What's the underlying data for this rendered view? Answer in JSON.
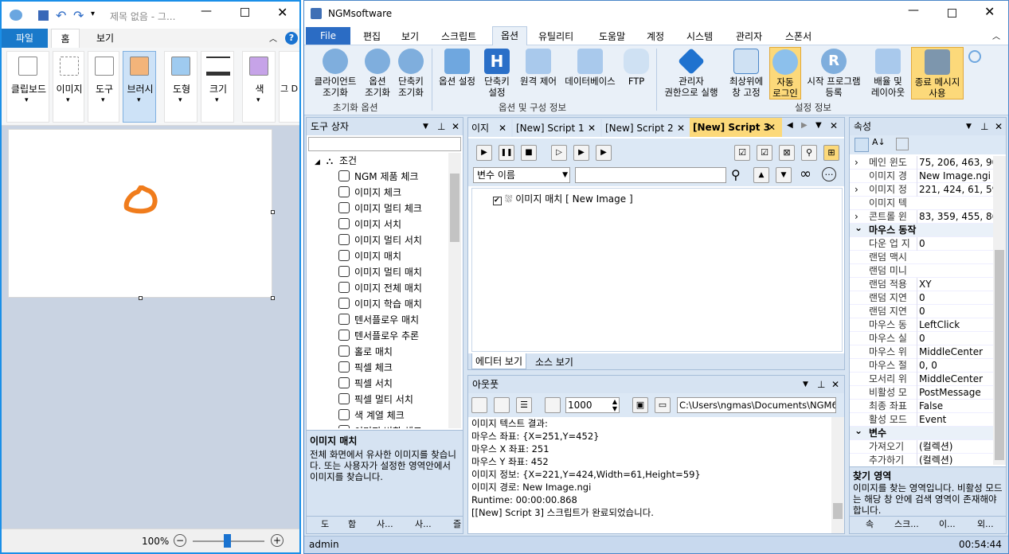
{
  "paint": {
    "title": "제목 없음 - 그...",
    "tabs": [
      "파일",
      "홈",
      "보기"
    ],
    "groups": [
      {
        "label": "클립보드",
        "icon": "clipboard-icon"
      },
      {
        "label": "이미지",
        "icon": "image-select-icon"
      },
      {
        "label": "도구",
        "icon": "tools-icon"
      },
      {
        "label": "브러시",
        "icon": "brush-icon"
      },
      {
        "label": "도형",
        "icon": "shapes-icon"
      },
      {
        "label": "크기",
        "icon": "size-icon"
      },
      {
        "label": "색",
        "icon": "color-icon"
      },
      {
        "label": "그 D",
        "icon": "paint3d-icon"
      }
    ],
    "zoom": "100%"
  },
  "ngm": {
    "title": "NGMsoftware",
    "menu": [
      "File",
      "편집",
      "보기",
      "스크립트",
      "옵션",
      "유틸리티",
      "도움말",
      "계정",
      "시스템",
      "관리자",
      "스폰서"
    ],
    "ribbon": {
      "buttons": [
        {
          "label1": "클라이언트",
          "label2": "조기화"
        },
        {
          "label1": "옵션",
          "label2": "조기화"
        },
        {
          "label1": "단축키",
          "label2": "조기화"
        },
        {
          "label1": "옵션 설정",
          "label2": ""
        },
        {
          "label1": "단축키",
          "label2": "설정"
        },
        {
          "label1": "원격 제어",
          "label2": ""
        },
        {
          "label1": "데이터베이스",
          "label2": ""
        },
        {
          "label1": "FTP",
          "label2": ""
        },
        {
          "label1": "관리자",
          "label2": "권한으로 실행"
        },
        {
          "label1": "최상위에",
          "label2": "창 고정"
        },
        {
          "label1": "자동",
          "label2": "로그인"
        },
        {
          "label1": "시작 프로그램",
          "label2": "등록"
        },
        {
          "label1": "배율 및",
          "label2": "레이아웃"
        },
        {
          "label1": "종료 메시지",
          "label2": "사용"
        }
      ],
      "groups": [
        "초기화 옵션",
        "옵션 및 구성 정보",
        "설정 정보"
      ]
    },
    "toolbox": {
      "title": "도구 상자",
      "root": "조건",
      "items": [
        "NGM 제품 체크",
        "이미지 체크",
        "이미지 멀티 체크",
        "이미지 서치",
        "이미지 멀티 서치",
        "이미지 매치",
        "이미지 멀티 매치",
        "이미지 전체 매치",
        "이미지 학습 매치",
        "텐서플로우 매치",
        "텐서플로우 추론",
        "홀로 매치",
        "픽셀 체크",
        "픽셀 서치",
        "픽셀 멀티 서치",
        "색 계열 체크",
        "이미지 변화 체크"
      ],
      "desc_title": "이미지 매치",
      "desc": "전체 화면에서 유사한 이미지를 찾습니다. 또는 사용자가 설정한 영역안에서 이미지를 찾습니다.",
      "bottom_tabs": [
        "도",
        "함",
        "사...",
        "사...",
        "즐"
      ]
    },
    "editor": {
      "tabs": [
        "이지",
        "[New] Script 1",
        "[New] Script 2",
        "[New] Script 3"
      ],
      "variable_select": "변수 이름",
      "script_line": "이미지 매치 [ New Image ]",
      "view_tabs": [
        "에디터 보기",
        "소스 보기"
      ]
    },
    "output": {
      "title": "아웃풋",
      "count": "1000",
      "path": "C:\\Users\\ngmas\\Documents\\NGM6\\",
      "lines": [
        "이미지 텍스트 결과:",
        "마우스 좌표: {X=251,Y=452}",
        "마우스 X 좌표: 251",
        "마우스 Y 좌표: 452",
        "이미지 정보: {X=221,Y=424,Width=61,Height=59}",
        "이미지 경로: New Image.ngi",
        "Runtime: 00:00:00.868",
        "[[New] Script 3] 스크립트가 완료되었습니다."
      ]
    },
    "properties": {
      "title": "속성",
      "rows": [
        {
          "k": "메인 윈도",
          "v": "75, 206, 463, 902",
          "expand": true
        },
        {
          "k": "이미지 경",
          "v": "New Image.ngi",
          "expand": false
        },
        {
          "k": "이미지 정",
          "v": "221, 424, 61, 59",
          "expand": true
        },
        {
          "k": "이미지 텍",
          "v": "",
          "expand": false
        },
        {
          "k": "콘트롤 윈",
          "v": "83, 359, 455, 868",
          "expand": true
        }
      ],
      "section1": "마우스 동작",
      "rows2": [
        {
          "k": "다운 업 지",
          "v": "0"
        },
        {
          "k": "랜덤 맥시",
          "v": ""
        },
        {
          "k": "랜덤 미니",
          "v": ""
        },
        {
          "k": "랜덤 적용",
          "v": "XY"
        },
        {
          "k": "랜덤 지연",
          "v": "0"
        },
        {
          "k": "랜덤 지연",
          "v": "0"
        },
        {
          "k": "마우스 동",
          "v": "LeftClick"
        },
        {
          "k": "마우스 실",
          "v": "0"
        },
        {
          "k": "마우스 위",
          "v": "MiddleCenter"
        },
        {
          "k": "마우스 절",
          "v": "0, 0"
        },
        {
          "k": "모서리 위",
          "v": "MiddleCenter"
        },
        {
          "k": "비활성 모",
          "v": "PostMessage"
        },
        {
          "k": "최종 좌표",
          "v": "False"
        },
        {
          "k": "활성 모드",
          "v": "Event"
        }
      ],
      "section2": "변수",
      "rows3": [
        {
          "k": "가져오기",
          "v": "(컬렉션)"
        },
        {
          "k": "추가하기",
          "v": "(컬렉션)"
        }
      ],
      "desc_title": "찾기 영역",
      "desc": "이미지를 찾는 영역입니다. 비활성 모드는 해당 창 안에 검색 영역이 존재해야 합니다.",
      "bottom_tabs": [
        "속",
        "스크...",
        "이...",
        "외..."
      ]
    },
    "status": {
      "user": "admin",
      "time": "00:54:44"
    }
  },
  "colors": {
    "accent": "#1a8fe8",
    "file_tab": "#2b6cc4",
    "orange_shape": "#f07c1c"
  }
}
